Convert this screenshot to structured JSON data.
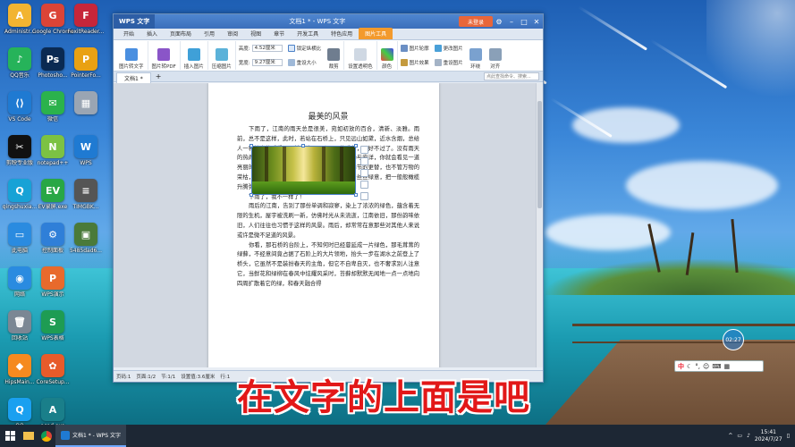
{
  "desktop": {
    "icons": [
      {
        "label": "Administr...",
        "glyph": "A",
        "color": "#f2b431"
      },
      {
        "label": "Google Chrome",
        "glyph": "G",
        "color": "#db4437"
      },
      {
        "label": "FoxitReader...",
        "glyph": "F",
        "color": "#c6263a"
      },
      {
        "label": "QQ音乐",
        "glyph": "♪",
        "color": "#26b35a"
      },
      {
        "label": "Photosho...",
        "glyph": "Ps",
        "color": "#0a2a52"
      },
      {
        "label": "PointerFo...",
        "glyph": "P",
        "color": "#e9a113"
      },
      {
        "label": "VS Code",
        "glyph": "⟨⟩",
        "color": "#1f7ad2"
      },
      {
        "label": "微信",
        "glyph": "✉",
        "color": "#2bb24c"
      },
      {
        "label": "",
        "glyph": "▦",
        "color": "#9aa5b3"
      },
      {
        "label": "剪映专业版",
        "glyph": "✂",
        "color": "#111111"
      },
      {
        "label": "notepad++",
        "glyph": "N",
        "color": "#7cc243"
      },
      {
        "label": "WPS",
        "glyph": "W",
        "color": "#1f7ad2"
      },
      {
        "label": "qingshuxia...",
        "glyph": "Q",
        "color": "#17a2d6"
      },
      {
        "label": "EV录屏.exe",
        "glyph": "EV",
        "color": "#28a745"
      },
      {
        "label": "TIMGBK...",
        "glyph": "≡",
        "color": "#555555"
      },
      {
        "label": "此电脑",
        "glyph": "▭",
        "color": "#2a8be0"
      },
      {
        "label": "控制面板",
        "glyph": "⚙",
        "color": "#2f7fd8"
      },
      {
        "label": "5485dad6...",
        "glyph": "▣",
        "color": "#4a7a3a"
      },
      {
        "label": "网络",
        "glyph": "◉",
        "color": "#2a8be0"
      },
      {
        "label": "WPS演示",
        "glyph": "P",
        "color": "#e86a2c"
      },
      {
        "label": "",
        "glyph": "",
        "color": "#000000"
      },
      {
        "label": "回收站",
        "glyph": "🗑",
        "color": "#7b8794"
      },
      {
        "label": "WPS表格",
        "glyph": "S",
        "color": "#1e9c53"
      },
      {
        "label": "",
        "glyph": "",
        "color": "#000000"
      },
      {
        "label": "HipsMain...",
        "glyph": "◆",
        "color": "#f58a1f"
      },
      {
        "label": "CoreSetup...",
        "glyph": "✿",
        "color": "#e75b2a"
      },
      {
        "label": "",
        "glyph": "",
        "color": "#000000"
      },
      {
        "label": "QQ",
        "glyph": "Q",
        "color": "#1aa0f0"
      },
      {
        "label": "acad.exe",
        "glyph": "A",
        "color": "#1a7f8a"
      }
    ]
  },
  "window": {
    "app_button": "WPS 文字",
    "doc_tab": "文档1 * - WPS 文字",
    "login_button": "未登录",
    "tabs": [
      "开始",
      "插入",
      "页面布局",
      "引用",
      "审阅",
      "视图",
      "章节",
      "开发工具",
      "特色应用",
      "图片工具"
    ],
    "active_tab": "图片工具",
    "ribbon": {
      "picture_to_text": "图片转文字",
      "picture_to_pdf": "图片转PDF",
      "insert_picture": "插入图片",
      "compress_picture": "压缩图片",
      "height_label": "高度:",
      "height_value": "4.52厘米",
      "width_label": "宽度:",
      "width_value": "9.27厘米",
      "lock_ratio": "锁定纵横比",
      "reset_size": "重设大小",
      "crop": "裁剪",
      "set_transparent": "设置透明色",
      "color": "颜色",
      "picture_outline": "图片轮廓",
      "picture_effect": "图片效果",
      "change_picture": "更改图片",
      "reset_picture": "重设图片",
      "wrap": "环绕",
      "align": "对齐"
    },
    "doc_tab_strip": {
      "tab": "文档1 *",
      "search_placeholder": "点此查找命令、搜索..."
    },
    "document": {
      "title": "最美的风景",
      "paragraphs": [
        "下雨了，江南的雨天总是很美，宛如初放的百合，清新、淡雅。雨前，总不是这样，此时，若站在石桥上，只见远山如黛，近水含烟，总给人一种惊喜的感受。雨前，这是一个下雨的季节，再好不过了。没有雨天的热闹，没有晴天的燥热，有的，只是那份宁静与安详，你就会看见一道亮丽的风景：它不知疲倦地滋润着大地，不管季节的更替，也不管万物的荣枯，永远是那样不紧不慢，落进山间中，连着丝丝绿意，把一般般橄榄升腾弥散在空气中，这景象让你怦然心动。",
        "下雨了，我不一样了！",
        "雨后的江南，告别了那份单调和寂寥，染上了浓浓的绿色，蕴含着无限的生机，屋宇被洗刷一新，仿佛时光从未流逝，江南依旧，那份韵味依旧，人们往往也习惯于这样的风景。雨后，却常常在意那些对其他人来说或许是微不足道的风景。",
        "你看，那石桥的台阶上，不知何时已经蔓延成一片绿色，那毛茸茸的绿藓，不经意间竟占据了石阶上的大片领地，抬头一步在湖水之前登上了桥头，它虽然不是装扮春天的主角，但它不自卑自灭，也不奢求别人注意它，当鲜花和绿柳在春风中炫耀风采时，苔藓却默默无闻地一点一点地向四周扩散着它的绿，和春天融合得"
      ]
    },
    "statusbar": {
      "page": "页码:1",
      "pages": "页面:1/2",
      "section": "节:1/1",
      "settings": "设置值:3.6厘米",
      "row": "行:1"
    }
  },
  "ime": {
    "label": "中"
  },
  "floating_badge": "02:27",
  "subtitle": "在文字的上面是吧",
  "taskbar": {
    "wps_item": "文档1 * - WPS 文字",
    "time": "15:41",
    "date": "2024/7/27"
  }
}
